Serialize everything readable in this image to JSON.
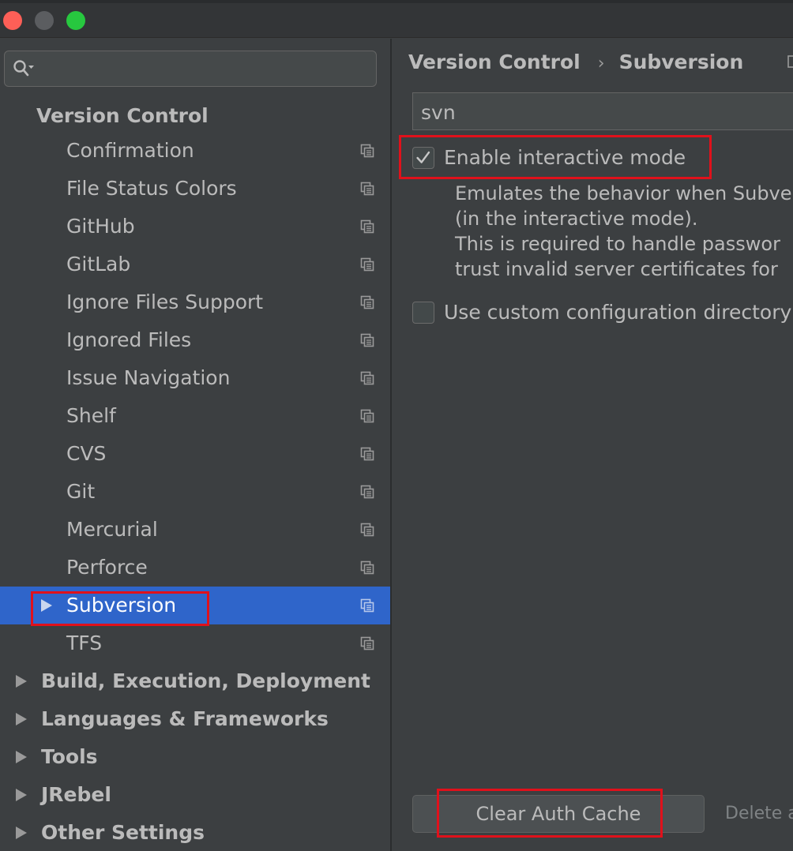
{
  "window": {
    "close_color": "#fd5f57",
    "minimize_color": "#5b5d60",
    "maximize_color": "#27c83f"
  },
  "search": {
    "icon": "search-icon",
    "value": ""
  },
  "tree": {
    "heading": "Version Control",
    "children": [
      {
        "label": "Confirmation"
      },
      {
        "label": "File Status Colors"
      },
      {
        "label": "GitHub"
      },
      {
        "label": "GitLab"
      },
      {
        "label": "Ignore Files Support"
      },
      {
        "label": "Ignored Files"
      },
      {
        "label": "Issue Navigation"
      },
      {
        "label": "Shelf"
      },
      {
        "label": "CVS"
      },
      {
        "label": "Git"
      },
      {
        "label": "Mercurial"
      },
      {
        "label": "Perforce"
      },
      {
        "label": "Subversion"
      },
      {
        "label": "TFS"
      }
    ],
    "selected": "Subversion",
    "sections": [
      {
        "label": "Build, Execution, Deployment"
      },
      {
        "label": "Languages & Frameworks"
      },
      {
        "label": "Tools"
      },
      {
        "label": "JRebel"
      },
      {
        "label": "Other Settings"
      }
    ]
  },
  "content": {
    "breadcrumb": {
      "parent": "Version Control",
      "separator": "›",
      "current": "Subversion"
    },
    "path_value": "svn",
    "interactive_mode": {
      "label": "Enable interactive mode",
      "checked": true,
      "description": [
        "Emulates the behavior when Subve",
        "(in the interactive mode).",
        "This is required to handle passwor",
        "trust invalid server certificates for"
      ]
    },
    "custom_config": {
      "label": "Use custom configuration directory",
      "checked": false
    },
    "clear_button": "Clear Auth Cache",
    "clear_hint": "Delete a"
  },
  "highlight_color": "#e0111b",
  "selection_color": "#2f65ca"
}
